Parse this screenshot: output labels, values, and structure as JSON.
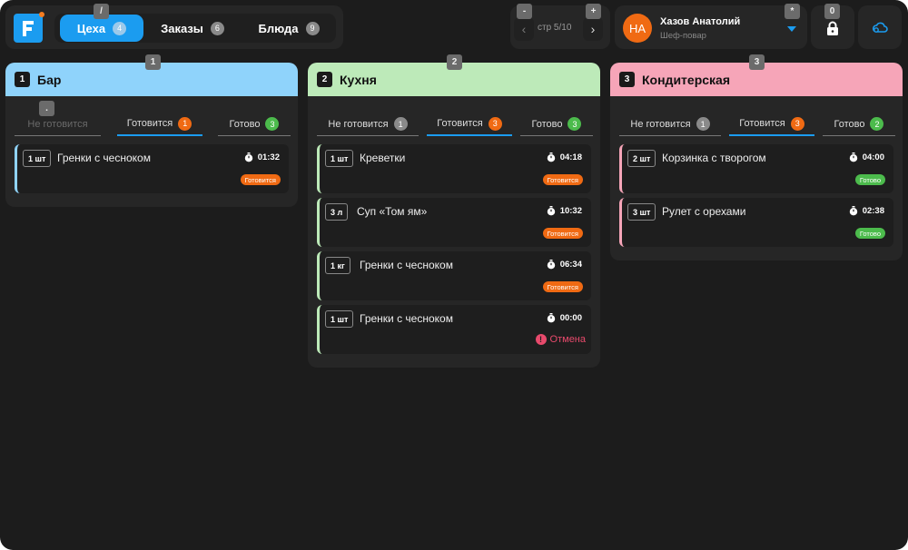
{
  "nav": {
    "tabs": [
      {
        "label": "Цеха",
        "count": "4"
      },
      {
        "label": "Заказы",
        "count": "6"
      },
      {
        "label": "Блюда",
        "count": "9"
      }
    ]
  },
  "pager": {
    "text": "стр 5/10",
    "prev": "‹",
    "next": "›"
  },
  "user": {
    "initials": "НА",
    "name": "Хазов Анатолий",
    "role": "Шеф-повар"
  },
  "hints": {
    "slash": "/",
    "minus": "-",
    "plus": "+",
    "star": "*",
    "zero": "0",
    "dot": ".",
    "c1": "1",
    "c2": "2",
    "c3": "3"
  },
  "colors": {
    "accent": "#1b9cf0",
    "bar": "#8fd3fb",
    "kitchen": "#bdeab9",
    "pastry": "#f6a5b8"
  },
  "columns": [
    {
      "num": "1",
      "title": "Бар",
      "tabs": [
        {
          "label": "Не готовится",
          "count": ""
        },
        {
          "label": "Готовится",
          "count": "1"
        },
        {
          "label": "Готово",
          "count": "3"
        }
      ],
      "cards": [
        {
          "qty": "1 шт",
          "name": "Гренки с чесноком",
          "time": "01:32",
          "status": "Готовится"
        }
      ]
    },
    {
      "num": "2",
      "title": "Кухня",
      "tabs": [
        {
          "label": "Не готовится",
          "count": "1"
        },
        {
          "label": "Готовится",
          "count": "3"
        },
        {
          "label": "Готово",
          "count": "3"
        }
      ],
      "cards": [
        {
          "qty": "1 шт",
          "name": "Креветки",
          "time": "04:18",
          "status": "Готовится"
        },
        {
          "qty": "3 л",
          "name": "Суп «Том ям»",
          "time": "10:32",
          "status": "Готовится"
        },
        {
          "qty": "1 кг",
          "name": "Гренки с чесноком",
          "time": "06:34",
          "status": "Готовится"
        },
        {
          "qty": "1 шт",
          "name": "Гренки с чесноком",
          "time": "00:00",
          "status": "Отмена"
        }
      ]
    },
    {
      "num": "3",
      "title": "Кондитерская",
      "tabs": [
        {
          "label": "Не готовится",
          "count": "1"
        },
        {
          "label": "Готовится",
          "count": "3"
        },
        {
          "label": "Готово",
          "count": "2"
        }
      ],
      "cards": [
        {
          "qty": "2 шт",
          "name": "Корзинка с творогом",
          "time": "04:00",
          "status": "Готово"
        },
        {
          "qty": "3 шт",
          "name": "Рулет с орехами",
          "time": "02:38",
          "status": "Готово"
        }
      ]
    }
  ]
}
